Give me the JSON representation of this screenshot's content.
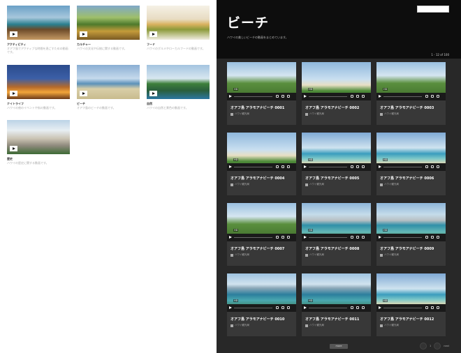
{
  "categories": [
    {
      "name": "アクティビティ",
      "desc": "オアフ島でアクティブな時間を過ごすための動画です。",
      "img": "people"
    },
    {
      "name": "カルチャー",
      "desc": "ハワイの文化や伝統に関する動画です。",
      "img": "forest"
    },
    {
      "name": "フード",
      "desc": "ハワイのグルメやローカルフードの動画です。",
      "img": "food"
    },
    {
      "name": "ナイトライフ",
      "desc": "ハワイの夜のイベントや街の動画です。",
      "img": "night"
    },
    {
      "name": "ビーチ",
      "desc": "オアフ島のビーチの動画です。",
      "img": "shore"
    },
    {
      "name": "自然",
      "desc": "ハワイの自然と景色の動画です。",
      "img": "cliff"
    },
    {
      "name": "歴史",
      "desc": "ハワイの歴史に関する動画です。",
      "img": "palace"
    }
  ],
  "panel": {
    "title": "ビーチ",
    "intro": "ハワイの美しいビーチの動画をまとめています。",
    "count": "1 - 12 of 100",
    "more_label": "more",
    "pager_label": "next"
  },
  "videos": [
    {
      "title": "オアフ島 アラモアナビーチ 0001",
      "sub": "ハワイ観光局",
      "img": "green",
      "cap": "HD"
    },
    {
      "title": "オアフ島 アラモアナビーチ 0002",
      "sub": "ハワイ観光局",
      "img": "sky",
      "cap": "HD"
    },
    {
      "title": "オアフ島 アラモアナビーチ 0003",
      "sub": "ハワイ観光局",
      "img": "green",
      "cap": "HD"
    },
    {
      "title": "オアフ島 アラモアナビーチ 0004",
      "sub": "ハワイ観光局",
      "img": "sky",
      "cap": "HD"
    },
    {
      "title": "オアフ島 アラモアナビーチ 0005",
      "sub": "ハワイ観光局",
      "img": "sea",
      "cap": "HD"
    },
    {
      "title": "オアフ島 アラモアナビーチ 0006",
      "sub": "ハワイ観光局",
      "img": "sea",
      "cap": "HD"
    },
    {
      "title": "オアフ島 アラモアナビーチ 0007",
      "sub": "ハワイ観光局",
      "img": "green",
      "cap": "HD"
    },
    {
      "title": "オアフ島 アラモアナビーチ 0008",
      "sub": "ハワイ観光局",
      "img": "city",
      "cap": "HD"
    },
    {
      "title": "オアフ島 アラモアナビーチ 0009",
      "sub": "ハワイ観光局",
      "img": "city",
      "cap": "HD"
    },
    {
      "title": "オアフ島 アラモアナビーチ 0010",
      "sub": "ハワイ観光局",
      "img": "aerial",
      "cap": "HD"
    },
    {
      "title": "オアフ島 アラモアナビーチ 0011",
      "sub": "ハワイ観光局",
      "img": "aerial",
      "cap": "HD"
    },
    {
      "title": "オアフ島 アラモアナビーチ 0012",
      "sub": "ハワイ観光局",
      "img": "sea",
      "cap": "HD"
    }
  ]
}
